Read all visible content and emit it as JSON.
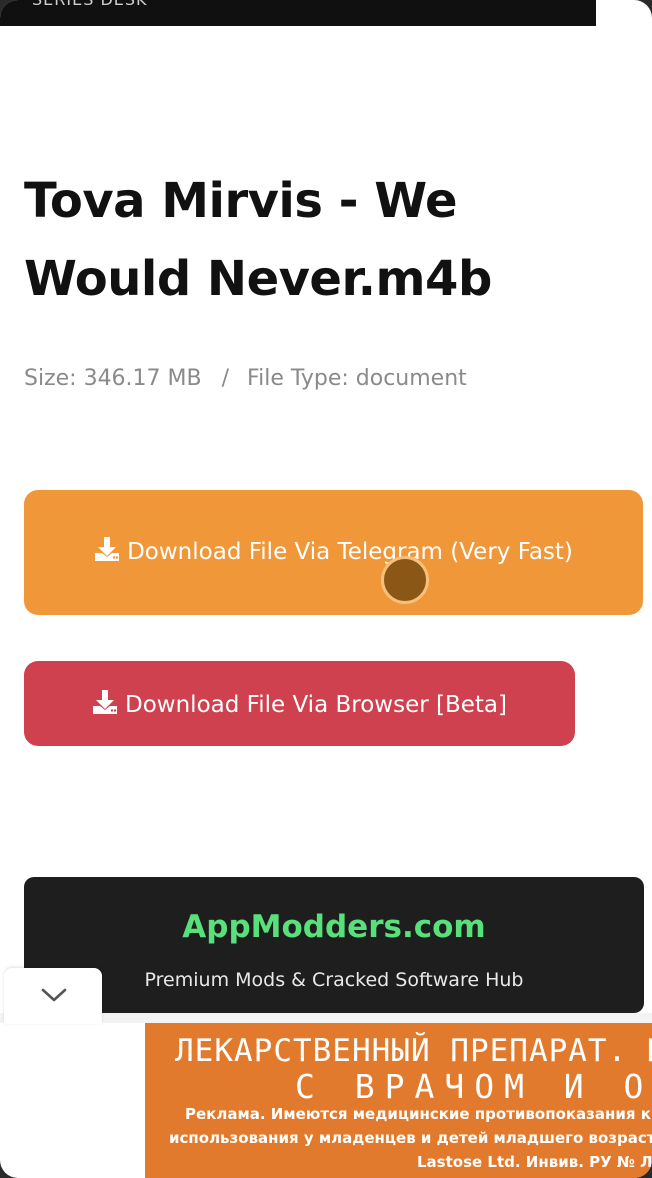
{
  "header": {
    "clipped_text": "SERIES DESK"
  },
  "file": {
    "title": "Tova Mirvis - We Would Never.m4b",
    "size_label": "Size: 346.17 MB",
    "separator": "/",
    "type_label": "File Type: document"
  },
  "buttons": {
    "telegram_label": "Download File Via Telegram (Very Fast)",
    "browser_label": "Download File Via Browser [Beta]"
  },
  "ad": {
    "site_name": "AppModders.com",
    "tagline": "Premium Mods & Cracked Software Hub",
    "banner_line1": "ЛЕКАРСТВЕННЫЙ ПРЕПАРАТ. П",
    "banner_line2": "С ВРАЧОМ И ОЗН",
    "banner_line3": "Реклама. Имеются медицинские противопоказания к при",
    "banner_line4": "использования у младенцев и детей младшего возраста (д",
    "banner_line5": "Lastose Ltd. Инвив. РУ № Л"
  },
  "icons": {
    "download": "download-icon",
    "collapse": "chevron-down-icon"
  },
  "colors": {
    "telegram_button": "#f0973a",
    "browser_button": "#cf414f",
    "ad_site_green": "#58e07a",
    "ad_banner_orange": "#e17a2c"
  }
}
